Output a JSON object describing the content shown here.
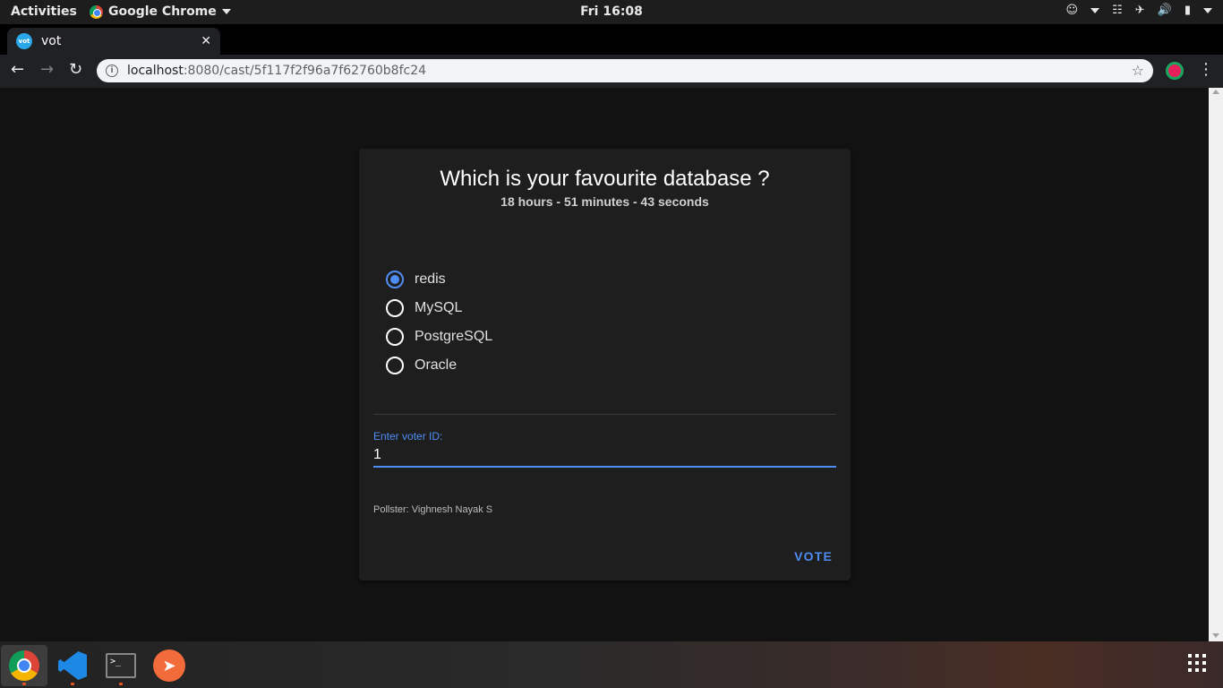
{
  "topbar": {
    "activities": "Activities",
    "app_name": "Google Chrome",
    "clock": "Fri 16:08"
  },
  "browser": {
    "tab_title": "vot",
    "favicon_text": "vot",
    "url_host": "localhost",
    "url_path": ":8080/cast/5f117f2f96a7f62760b8fc24"
  },
  "poll": {
    "question": "Which is your favourite database ?",
    "time_remaining": "18 hours - 51 minutes - 43 seconds",
    "options": [
      {
        "label": "redis",
        "selected": true
      },
      {
        "label": "MySQL",
        "selected": false
      },
      {
        "label": "PostgreSQL",
        "selected": false
      },
      {
        "label": "Oracle",
        "selected": false
      }
    ],
    "voter_id_label": "Enter voter ID:",
    "voter_id_value": "1",
    "pollster": "Pollster: Vighnesh Nayak S",
    "vote_button": "VOTE"
  },
  "colors": {
    "accent": "#4f8df5",
    "card_bg": "#1e1e1e",
    "page_bg": "#121212"
  },
  "dock": {
    "apps": [
      "chrome-icon",
      "vscode-icon",
      "terminal-icon",
      "postman-icon"
    ]
  }
}
